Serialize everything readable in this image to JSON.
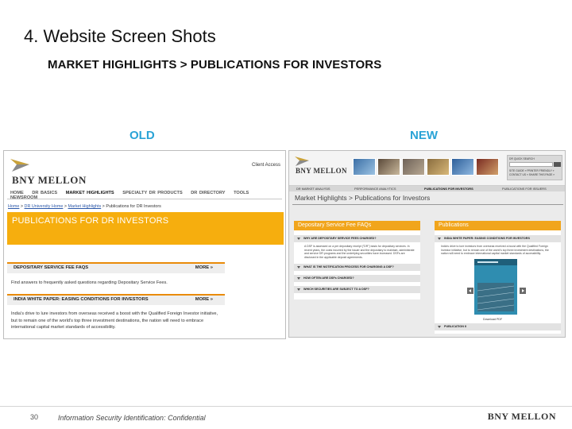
{
  "slide": {
    "title": "4. Website Screen Shots",
    "subtitle": "MARKET HIGHLIGHTS > PUBLICATIONS FOR INVESTORS",
    "label_old": "OLD",
    "label_new": "NEW",
    "colors": {
      "label_accent": "#2aa3d6"
    }
  },
  "old_site": {
    "brand": "BNY MELLON",
    "client_access": "Client Access",
    "nav": [
      "HOME",
      "DR BASICS",
      "MARKET HIGHLIGHTS",
      "SPECIALTY DR PRODUCTS",
      "DR DIRECTORY",
      "TOOLS",
      "NEWSROOM"
    ],
    "breadcrumb": {
      "home": "Home",
      "sep1": " > ",
      "university": "DR University Home",
      "sep2": " > ",
      "market": "Market Highlights",
      "sep3": " > ",
      "current": "Publications for DR Investors"
    },
    "banner_title": "PUBLICATIONS FOR DR INVESTORS",
    "sections": [
      {
        "title": "DEPOSITARY SERVICE FEE FAQS",
        "more": "MORE »",
        "text": "Find answers to frequently asked questions regarding Depositary Service Fees."
      },
      {
        "title": "INDIA WHITE PAPER: EASING CONDITIONS FOR INVESTORS",
        "more": "MORE »",
        "text": "India's drive to lure investors from overseas received a boost with the Qualified Foreign Investor initiative, but to remain one of the world's top three investment destinations, the nation will need to embrace international capital market standards of accessibility."
      }
    ],
    "colors": {
      "banner": "#f6ae0e",
      "section_rule": "#e98b0a",
      "link": "#2c58a8"
    }
  },
  "new_site": {
    "brand": "BNY MELLON",
    "search": {
      "label": "DR QUICK SEARCH",
      "links1": "SITE GUIDE »   PRINTER FRIENDLY »",
      "links2": "CONTACT US »   SHARE THIS PAGE »"
    },
    "nav": [
      "DR MARKET ANALYSIS",
      "PERFORMANCE ANALYTICS",
      "PUBLICATIONS FOR INVESTORS",
      "PUBLICATIONS FOR ISSUERS"
    ],
    "page_title": "Market Highlights > Publications for Investors",
    "left_panel": {
      "heading": "Depositary Service Fee FAQs",
      "first_question": "WHY ARE DEPOSITARY SERVICE FEES CHARGED?",
      "answer": "A DSF is assessed on a per depositary receipt (\"DR\") basis for depositary services. In recent years, the costs incurred by the issuer and the depositary to maintain, administrate and service DR programs and the underlying securities have increased. DSFs are disclosed in the applicable deposit agreements.",
      "questions": [
        "WHAT IS THE NOTIFICATION PROCESS FOR CHARGING A DSF?",
        "HOW OFTEN ARE DSFs CHARGED?",
        "WHICH SECURITIES ARE SUBJECT TO A DSF?"
      ]
    },
    "right_panel": {
      "heading": "Publications",
      "item_title": "INDIA WHITE PAPER: EASING CONDITIONS FOR INVESTORS",
      "item_text": "India's drive to lure investors from overseas received a boost with the Qualified Foreign Investor initiative, but to remain one of the world's top three investment destinations, the nation will need to embrace international capital market standards of accessibility.",
      "download": "Download PDF",
      "footer_item": "PUBLICATION II"
    },
    "colors": {
      "panel_heading": "#f1a51c",
      "book_cover": "#2f8db0"
    }
  },
  "footer": {
    "page_number": "30",
    "note": "Information Security Identification: Confidential",
    "brand": "BNY MELLON"
  }
}
